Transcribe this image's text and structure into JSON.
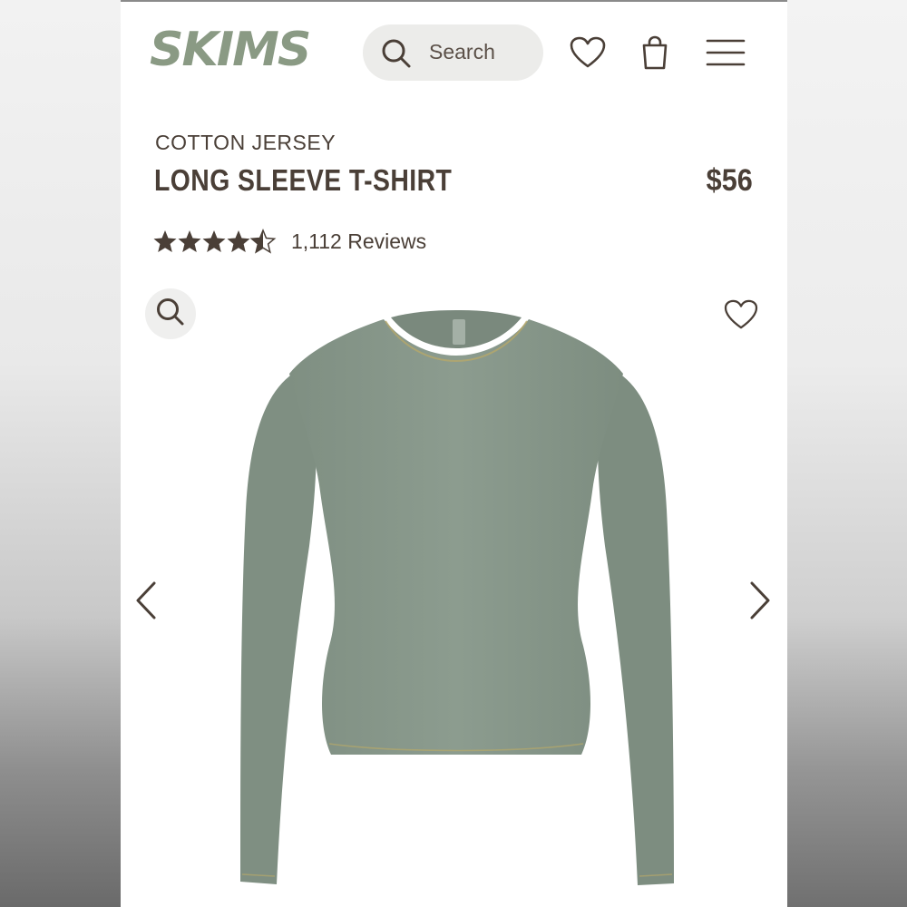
{
  "brand": {
    "logo_text": "SKIMS",
    "logo_color": "#8a9a84"
  },
  "header": {
    "search_label": "Search"
  },
  "product": {
    "eyebrow": "COTTON JERSEY",
    "title": "LONG SLEEVE T-SHIRT",
    "price": "$56",
    "rating": 4.5,
    "reviews_label": "1,112 Reviews",
    "color": "#8a9a8d"
  },
  "icons": {
    "search": "search-icon",
    "wishlist": "heart-icon",
    "bag": "shopping-bag-icon",
    "menu": "hamburger-menu-icon",
    "zoom": "zoom-icon",
    "prev": "chevron-left-icon",
    "next": "chevron-right-icon"
  },
  "colors": {
    "text": "#4a3f37",
    "search_bg": "#ececea",
    "icon": "#4a3f37"
  }
}
